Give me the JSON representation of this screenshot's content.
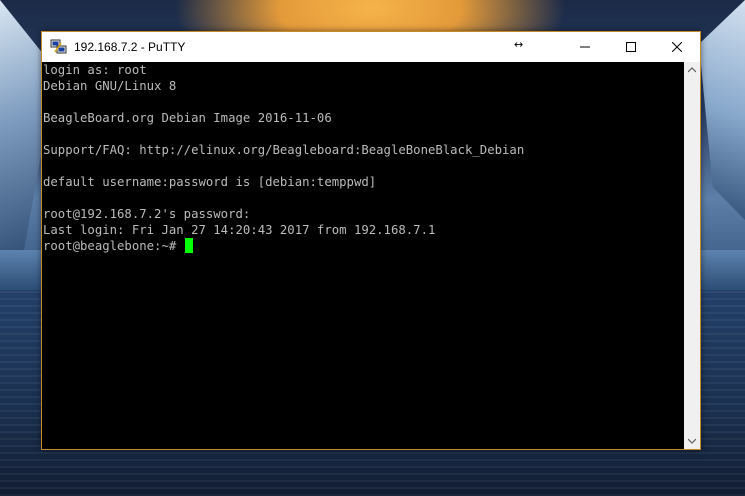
{
  "window": {
    "title": "192.168.7.2 - PuTTY",
    "resize_hint": "↔"
  },
  "terminal": {
    "lines": [
      "login as: root",
      "Debian GNU/Linux 8",
      "",
      "BeagleBoard.org Debian Image 2016-11-06",
      "",
      "Support/FAQ: http://elinux.org/Beagleboard:BeagleBoneBlack_Debian",
      "",
      "default username:password is [debian:temppwd]",
      "",
      "root@192.168.7.2's password:",
      "Last login: Fri Jan 27 14:20:43 2017 from 192.168.7.1"
    ],
    "prompt": "root@beaglebone:~# ",
    "cursor_color": "#00ff00",
    "text_color": "#bbbbbb",
    "background": "#000000"
  },
  "icons": {
    "app": "putty-icon",
    "minimize": "minimize-icon",
    "maximize": "maximize-icon",
    "close": "close-icon"
  }
}
